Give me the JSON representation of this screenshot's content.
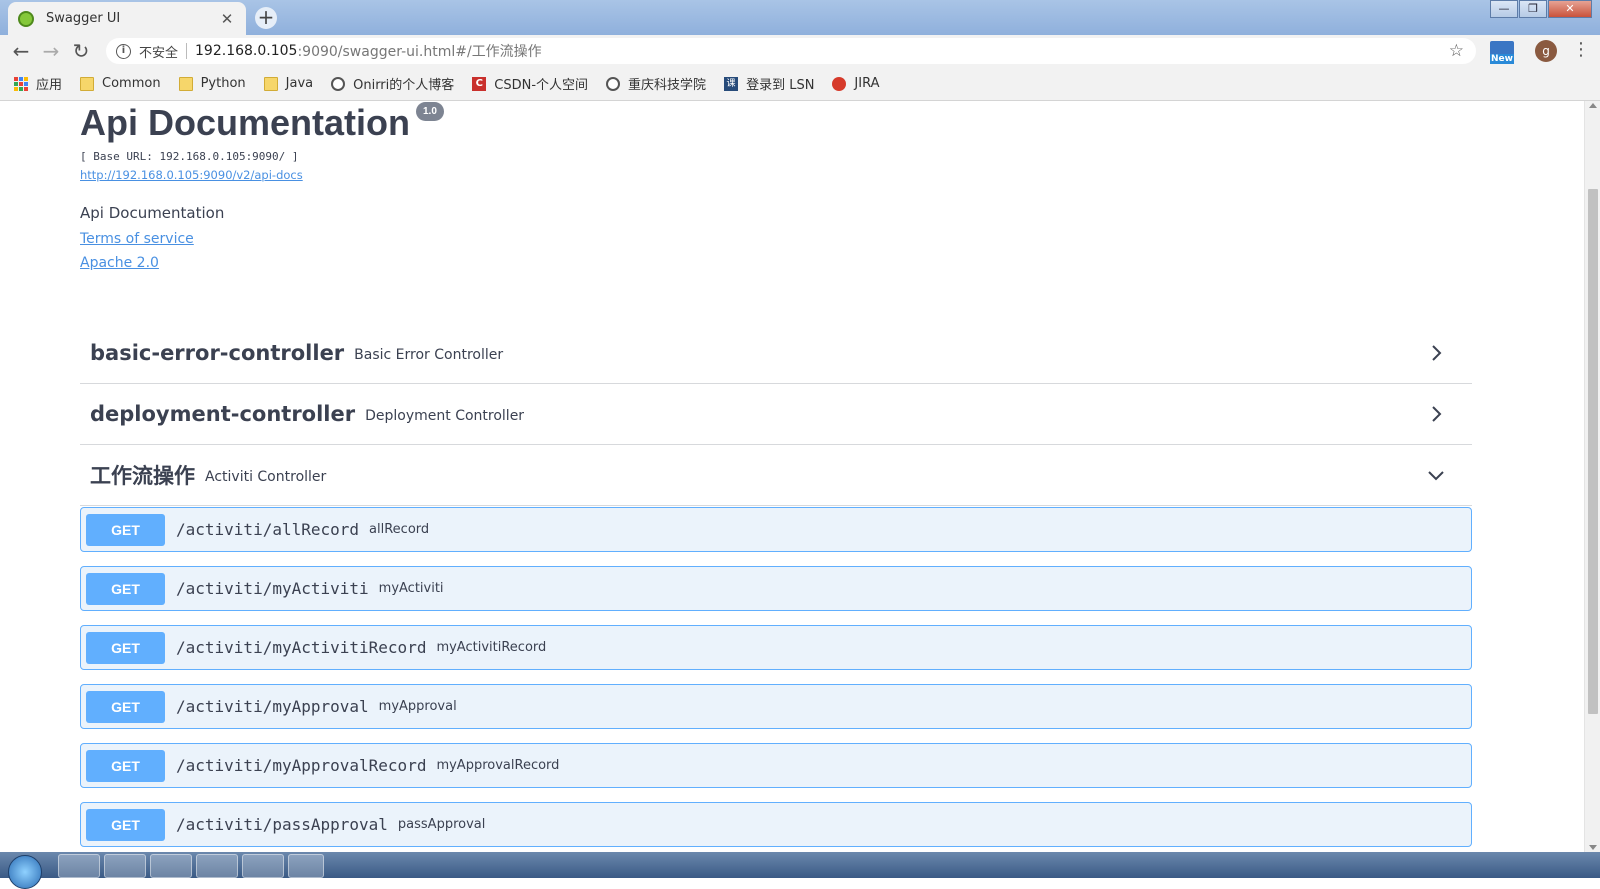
{
  "browser": {
    "tab": {
      "title": "Swagger UI",
      "close_glyph": "✕",
      "favicon": "swagger-favicon"
    },
    "new_tab_glyph": "+",
    "window_controls": {
      "minimize": "—",
      "restore": "❐",
      "close": "✕"
    },
    "address": {
      "security_label": "不安全",
      "url_host": "192.168.0.105",
      "url_rest": ":9090/swagger-ui.html#/工作流操作"
    },
    "extension_label": "New",
    "avatar_letter": "g",
    "bookmarks": [
      {
        "label": "应用",
        "icon": "apps-icon"
      },
      {
        "label": "Common",
        "icon": "folder-icon"
      },
      {
        "label": "Python",
        "icon": "folder-icon"
      },
      {
        "label": "Java",
        "icon": "folder-icon"
      },
      {
        "label": "Onirri的个人博客",
        "icon": "globe-icon"
      },
      {
        "label": "CSDN-个人空间",
        "icon": "csdn-icon"
      },
      {
        "label": "重庆科技学院",
        "icon": "globe-icon"
      },
      {
        "label": "登录到 LSN",
        "icon": "book-icon"
      },
      {
        "label": "JIRA",
        "icon": "jira-icon"
      }
    ]
  },
  "info": {
    "title": "Api Documentation",
    "version": "1.0",
    "base_url": "[ Base URL: 192.168.0.105:9090/ ]",
    "api_docs_url": "http://192.168.0.105:9090/v2/api-docs",
    "description": "Api Documentation",
    "terms_of_service": "Terms of service",
    "license": "Apache 2.0"
  },
  "tags": [
    {
      "name": "basic-error-controller",
      "description": "Basic Error Controller",
      "expanded": false
    },
    {
      "name": "deployment-controller",
      "description": "Deployment Controller",
      "expanded": false
    },
    {
      "name": "工作流操作",
      "description": "Activiti Controller",
      "expanded": true
    }
  ],
  "operations": [
    {
      "method": "GET",
      "path": "/activiti/allRecord",
      "summary": "allRecord"
    },
    {
      "method": "GET",
      "path": "/activiti/myActiviti",
      "summary": "myActiviti"
    },
    {
      "method": "GET",
      "path": "/activiti/myActivitiRecord",
      "summary": "myActivitiRecord"
    },
    {
      "method": "GET",
      "path": "/activiti/myApproval",
      "summary": "myApproval"
    },
    {
      "method": "GET",
      "path": "/activiti/myApprovalRecord",
      "summary": "myApprovalRecord"
    },
    {
      "method": "GET",
      "path": "/activiti/passApproval",
      "summary": "passApproval"
    }
  ],
  "colors": {
    "get_method": "#61affe",
    "get_background": "#ebf3fb",
    "link": "#4990e2",
    "text": "#3b4151"
  }
}
